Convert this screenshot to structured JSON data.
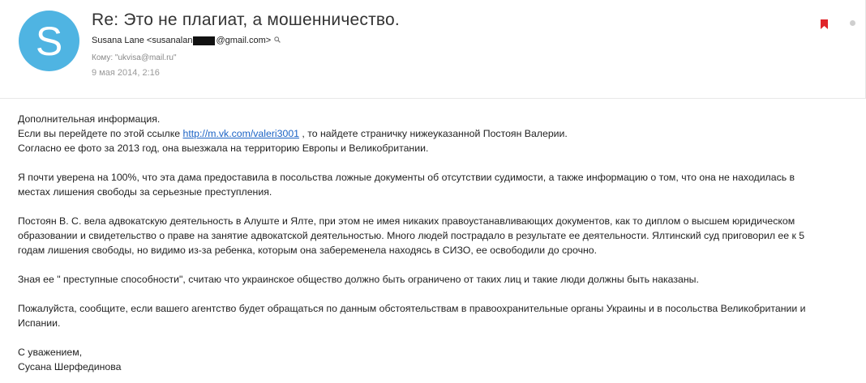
{
  "email": {
    "subject": "Re: Это не плагиат, а мошенничество.",
    "avatar_letter": "S",
    "sender_text_before": "Susana Lane <susanalan",
    "sender_text_after": "@gmail.com>",
    "recipient": "Кому: \"ukvisa@mail.ru\"",
    "date": "9 мая 2014, 2:16"
  },
  "body": {
    "p1_line1": "Дополнительная информация.",
    "p1_line2_before": "Если вы перейдете по этой ссылке ",
    "link_text": "http://m.vk.com/valeri3001",
    "p1_line2_after": " , то найдете страничку нижеуказанной Постоян Валерии.",
    "p1_line3": "Согласно ее фото за 2013 год, она выезжала на территорию Европы и Великобритании.",
    "p2": "Я почти уверена на 100%, что эта дама предоставила в посольства ложные документы об отсутствии судимости, а также информацию о том, что она не находилась в\nместах лишения свободы за серьезные преступления.",
    "p3": "Постоян В. С. вела адвокатскую деятельность в Алуште и Ялте, при этом не имея никаких правоустанавливающих документов, как то диплом о высшем юридическом\nобразовании и свидетельство о праве на занятие адвокатской деятельностью. Много людей пострадало в результате ее деятельности. Ялтинский суд приговорил ее к 5\nгодам лишения свободы, но видимо из-за ребенка, которым она забеременела находясь в СИЗО, ее освободили до срочно.",
    "p4": "Зная ее \" преступные способности\", считаю что украинское общество должно быть ограничено от таких лиц и такие люди должны быть наказаны.",
    "p5": "Пожалуйста, сообщите, если вашего агентство будет обращаться по данным обстоятельствам в правоохранительные органы Украины и в посольства Великобритании и\nИспании.",
    "closing": "С уважением,",
    "signature": "Сусана Шерфединова"
  },
  "icons": {
    "flag_color": "#e0242a",
    "avatar_color": "#4fb4e2",
    "link_color": "#1b63c5"
  }
}
